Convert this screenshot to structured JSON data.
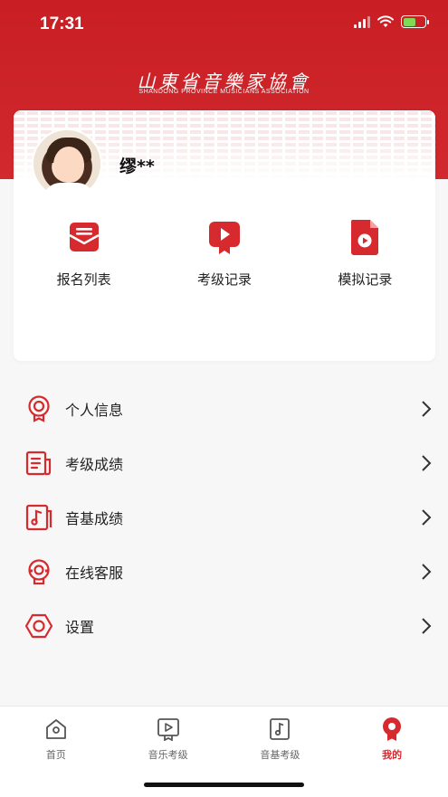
{
  "status": {
    "time": "17:31"
  },
  "header": {
    "logo_title": "山東省音樂家協會",
    "logo_subtitle": "SHANDONG PROVINCE MUSICIANS ASSOCIATION"
  },
  "profile": {
    "name": "缪**"
  },
  "quick_actions": [
    {
      "label": "报名列表",
      "icon": "mail-icon"
    },
    {
      "label": "考级记录",
      "icon": "video-play-icon"
    },
    {
      "label": "模拟记录",
      "icon": "video-file-icon"
    }
  ],
  "menu": [
    {
      "label": "个人信息",
      "icon": "badge-icon"
    },
    {
      "label": "考级成绩",
      "icon": "document-icon"
    },
    {
      "label": "音基成绩",
      "icon": "music-note-icon"
    },
    {
      "label": "在线客服",
      "icon": "headset-icon"
    },
    {
      "label": "设置",
      "icon": "settings-hexagon-icon"
    }
  ],
  "tabbar": [
    {
      "label": "首页",
      "icon": "home-icon",
      "active": false
    },
    {
      "label": "音乐考级",
      "icon": "play-board-icon",
      "active": false
    },
    {
      "label": "音基考级",
      "icon": "music-sheet-icon",
      "active": false
    },
    {
      "label": "我的",
      "icon": "profile-badge-icon",
      "active": true
    }
  ],
  "colors": {
    "brand_red": "#d62a2f",
    "header_red": "#c81e24",
    "background": "#f7f7f7"
  }
}
